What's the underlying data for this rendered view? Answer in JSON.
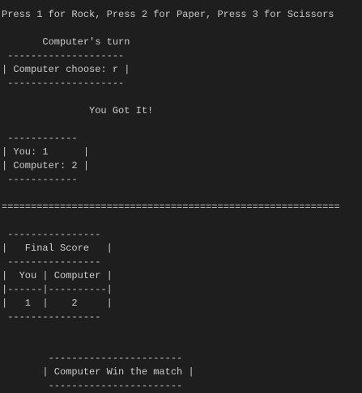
{
  "terminal": {
    "background": "#1e1e1e",
    "foreground": "#cccccc",
    "lines": [
      "Press 1 for Rock, Press 2 for Paper, Press 3 for Scissors",
      "",
      "       Computer's turn",
      " --------------------",
      "| Computer choose: r |",
      " --------------------",
      "",
      "",
      "               You Got It!",
      "",
      " ------------",
      "| You: 1      |",
      "| Computer: 2 |",
      " ------------",
      "",
      "==========================================================",
      "",
      " ----------------",
      "|   Final Score   |",
      " ----------------",
      "|  You | Computer |",
      "|------|----------|",
      "|   1  |    2     |",
      " ----------------",
      "",
      "",
      "",
      "        -----------------------",
      "       | Computer Win the match |",
      "        -----------------------"
    ]
  }
}
